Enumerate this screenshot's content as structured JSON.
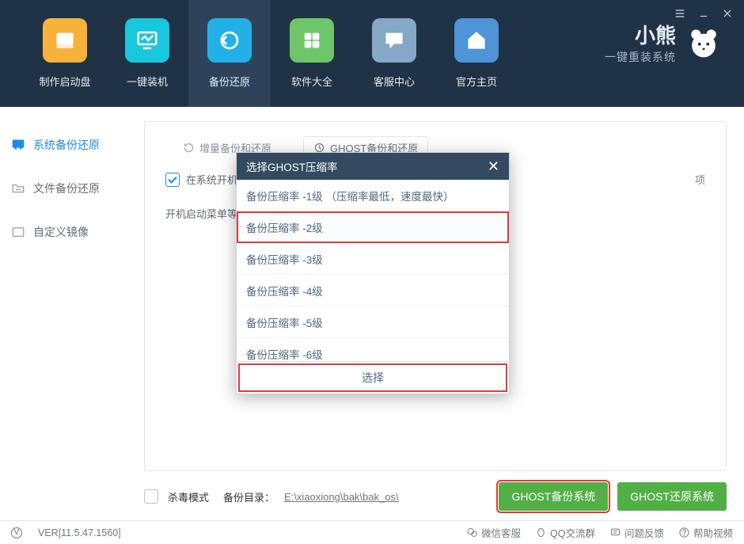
{
  "sysButtons": {
    "menu": "≡",
    "min": "–",
    "close": "×"
  },
  "nav": [
    {
      "label": "制作启动盘"
    },
    {
      "label": "一键装机"
    },
    {
      "label": "备份还原"
    },
    {
      "label": "软件大全"
    },
    {
      "label": "客服中心"
    },
    {
      "label": "官方主页"
    }
  ],
  "brand": {
    "title": "小熊",
    "sub": "一键重装系统"
  },
  "sidebar": [
    {
      "label": "系统备份还原"
    },
    {
      "label": "文件备份还原"
    },
    {
      "label": "自定义镜像"
    }
  ],
  "tabs": [
    {
      "label": "增量备份和还原"
    },
    {
      "label": "GHOST备份和还原"
    }
  ],
  "panel": {
    "chk_label": "在系统开机启",
    "row2_label": "开机启动菜单等待",
    "tail_text": "项"
  },
  "modal": {
    "title": "选择GHOST压缩率",
    "options": [
      "备份压缩率 -1级 （压缩率最低，速度最快）",
      "备份压缩率 -2级",
      "备份压缩率 -3级",
      "备份压缩率 -4级",
      "备份压缩率 -5级",
      "备份压缩率 -6级"
    ],
    "action": "选择"
  },
  "bottom": {
    "anti_label": "杀毒模式",
    "path_label": "备份目录：",
    "path_value": "E:\\xiaoxiong\\bak\\bak_os\\",
    "btn_backup": "GHOST备份系统",
    "btn_restore": "GHOST还原系统"
  },
  "status": {
    "version": "VER[11.5.47.1560]",
    "links": [
      "微信客服",
      "QQ交流群",
      "问题反馈",
      "帮助视频"
    ]
  }
}
